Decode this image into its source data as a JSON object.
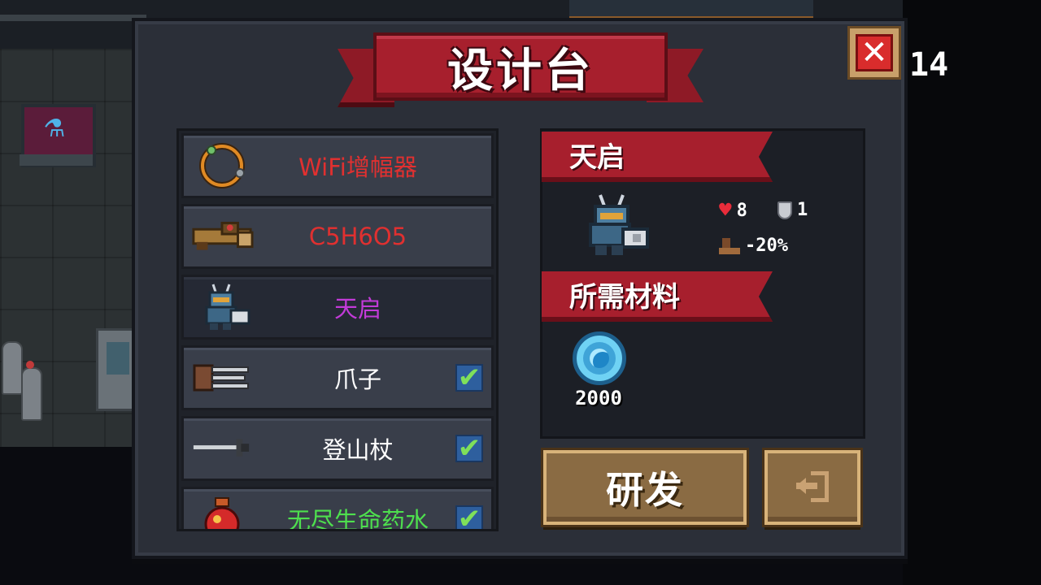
{
  "hud": {
    "counter": "14"
  },
  "dialog": {
    "title": "设计台",
    "close_label": "✕"
  },
  "items": [
    {
      "name": "WiFi增幅器",
      "icon": "ring-icon",
      "color": "#e03030",
      "unlocked": false,
      "selected": false
    },
    {
      "name": "C5H6O5",
      "icon": "cannon-icon",
      "color": "#e03030",
      "unlocked": false,
      "selected": false
    },
    {
      "name": "天启",
      "icon": "robot-knight-icon",
      "color": "#c23ad8",
      "unlocked": false,
      "selected": true
    },
    {
      "name": "爪子",
      "icon": "claw-icon",
      "color": "#ffffff",
      "unlocked": true,
      "selected": false
    },
    {
      "name": "登山杖",
      "icon": "pickaxe-icon",
      "color": "#ffffff",
      "unlocked": true,
      "selected": false
    },
    {
      "name": "无尽生命药水",
      "icon": "red-potion-icon",
      "color": "#4ee04e",
      "unlocked": true,
      "selected": false
    }
  ],
  "check_mark": "✔",
  "detail": {
    "name": "天启",
    "hp": "8",
    "armor": "1",
    "speed": "-20%",
    "materials_title": "所需材料",
    "materials": [
      {
        "icon": "blue-gem-icon",
        "count": "2000"
      }
    ]
  },
  "buttons": {
    "research": "研发",
    "exit_icon": "exit-icon"
  }
}
